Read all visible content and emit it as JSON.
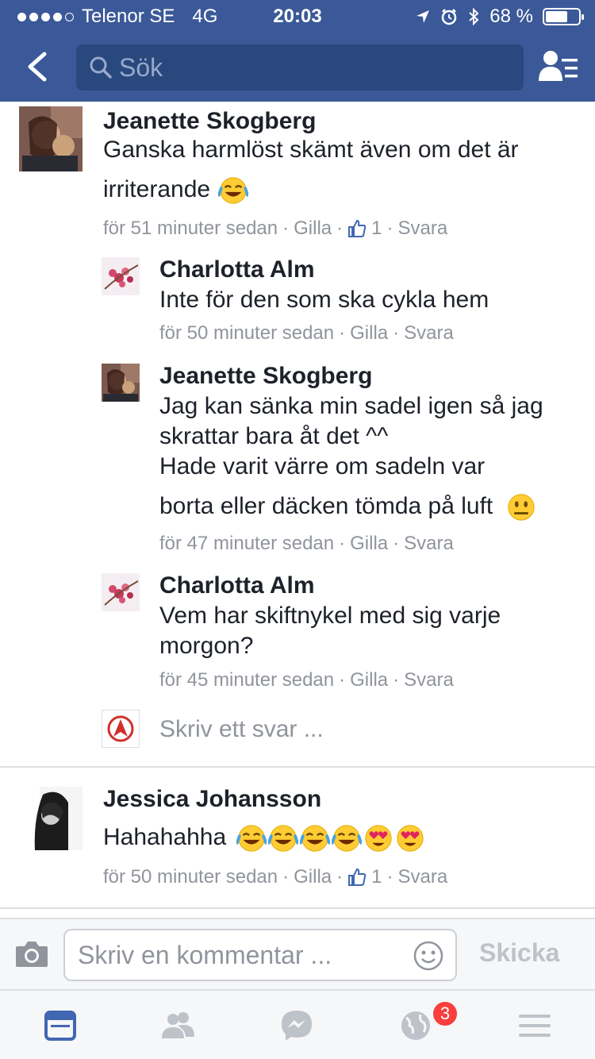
{
  "status_bar": {
    "carrier": "Telenor SE",
    "network": "4G",
    "time": "20:03",
    "battery": "68 %",
    "battery_level": 0.68
  },
  "nav": {
    "search_placeholder": "Sök",
    "colors": {
      "bar": "#3b5998",
      "search_bg": "#29487d"
    }
  },
  "comments": [
    {
      "author": "Jeanette Skogberg",
      "lines": [
        "Ganska harmlöst skämt även om det är",
        "irriterande"
      ],
      "emoji": [
        "joy"
      ],
      "time": "för 51 minuter sedan",
      "like_label": "Gilla",
      "like_count": "1",
      "reply_label": "Svara",
      "replies": [
        {
          "author": "Charlotta Alm",
          "lines": [
            "Inte för den som ska cykla hem"
          ],
          "time": "för 50 minuter sedan",
          "like_label": "Gilla",
          "reply_label": "Svara"
        },
        {
          "author": "Jeanette Skogberg",
          "lines": [
            "Jag kan sänka min sadel igen så jag",
            "skrattar bara åt det ^^",
            "Hade varit värre om sadeln var",
            "borta eller däcken tömda på luft"
          ],
          "emoji": [
            "neutral"
          ],
          "time": "för 47 minuter sedan",
          "like_label": "Gilla",
          "reply_label": "Svara"
        },
        {
          "author": "Charlotta Alm",
          "lines": [
            "Vem har skiftnykel med sig varje",
            "morgon?"
          ],
          "time": "för 45 minuter sedan",
          "like_label": "Gilla",
          "reply_label": "Svara"
        }
      ],
      "reply_placeholder": "Skriv ett svar ..."
    },
    {
      "author": "Jessica Johansson",
      "lines": [
        "Hahahahha"
      ],
      "emoji": [
        "joy",
        "joy",
        "joy",
        "joy",
        "heart-eyes",
        "heart-eyes"
      ],
      "time": "för 50 minuter sedan",
      "like_label": "Gilla",
      "like_count": "1",
      "reply_label": "Svara"
    }
  ],
  "composer": {
    "placeholder": "Skriv en kommentar ...",
    "send_label": "Skicka"
  },
  "tabbar": {
    "items": [
      "news-feed-icon",
      "friends-icon",
      "messenger-icon",
      "notifications-icon",
      "menu-icon"
    ],
    "notification_badge": "3",
    "active_color": "#4267b2",
    "inactive_color": "#bec3c9"
  }
}
